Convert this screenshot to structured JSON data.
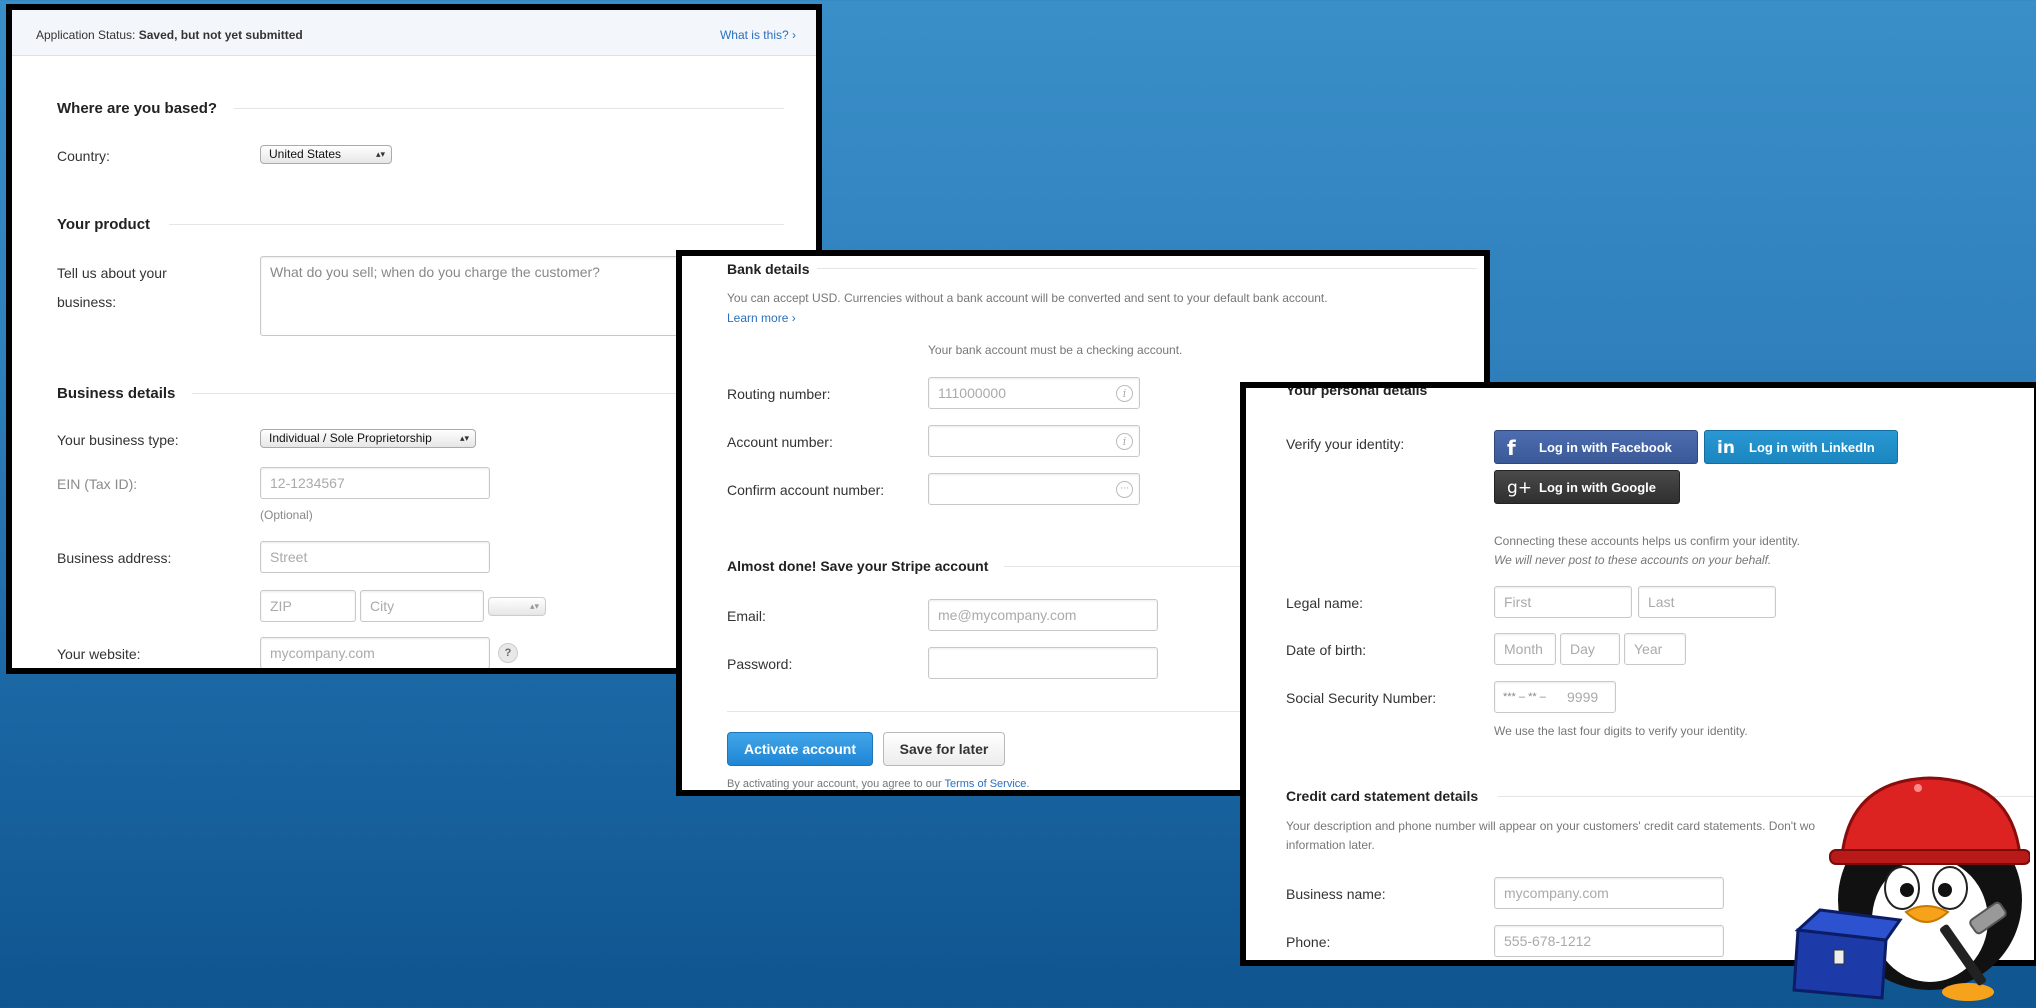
{
  "colors": {
    "accent": "#1f86d6",
    "facebook": "#3b5998",
    "linkedin": "#1b86bf",
    "google": "#333333",
    "link": "#2a6fc0"
  },
  "panel1": {
    "status_prefix": "Application Status:",
    "status_value": "Saved, but not yet submitted",
    "status_link": "What is this? ›",
    "where_based_title": "Where are you based?",
    "country_label": "Country:",
    "country_value": "United States",
    "product_title": "Your product",
    "business_about_label_1": "Tell us about your",
    "business_about_label_2": "business:",
    "business_about_placeholder": "What do you sell; when do you charge the customer?",
    "business_details_title": "Business details",
    "business_type_label": "Your business type:",
    "business_type_value": "Individual / Sole Proprietorship",
    "ein_label": "EIN (Tax ID):",
    "ein_placeholder": "12-1234567",
    "ein_optional": "(Optional)",
    "address_label": "Business address:",
    "street_placeholder": "Street",
    "zip_placeholder": "ZIP",
    "city_placeholder": "City",
    "website_label": "Your website:",
    "website_placeholder": "mycompany.com",
    "website_help": "?"
  },
  "panel2": {
    "bank_title": "Bank details",
    "bank_note": "You can accept USD. Currencies without a bank account will be converted and sent to your default bank account.",
    "learn_more": "Learn more ›",
    "checking_note": "Your bank account must be a checking account.",
    "routing_label": "Routing number:",
    "routing_placeholder": "111000000",
    "account_label": "Account number:",
    "confirm_label": "Confirm account number:",
    "save_title": "Almost done! Save your Stripe account",
    "email_label": "Email:",
    "email_placeholder": "me@mycompany.com",
    "password_label": "Password:",
    "activate_button": "Activate account",
    "save_later_button": "Save for later",
    "terms_prefix": "By activating your account, you agree to our",
    "terms_link": "Terms of Service",
    "terms_suffix": "."
  },
  "panel3": {
    "personal_title": "Your personal details",
    "verify_label": "Verify your identity:",
    "facebook_button": "Log in with Facebook",
    "linkedin_button": "Log in with LinkedIn",
    "google_button": "Log in with Google",
    "connect_note": "Connecting these accounts helps us confirm your identity.",
    "never_post_note": "We will never post to these accounts on your behalf.",
    "legal_name_label": "Legal name:",
    "first_placeholder": "First",
    "last_placeholder": "Last",
    "dob_label": "Date of birth:",
    "month_placeholder": "Month",
    "day_placeholder": "Day",
    "year_placeholder": "Year",
    "ssn_label": "Social Security Number:",
    "ssn_mask": "*** – ** –",
    "ssn_placeholder": "9999",
    "ssn_note": "We use the last four digits to verify your identity.",
    "cc_title": "Credit card statement details",
    "cc_note_1": "Your description and phone number will appear on your customers' credit card statements. Don't wo",
    "cc_note_2": "information later.",
    "business_name_label": "Business name:",
    "business_name_placeholder": "mycompany.com",
    "phone_label": "Phone:",
    "phone_placeholder": "555-678-1212"
  }
}
